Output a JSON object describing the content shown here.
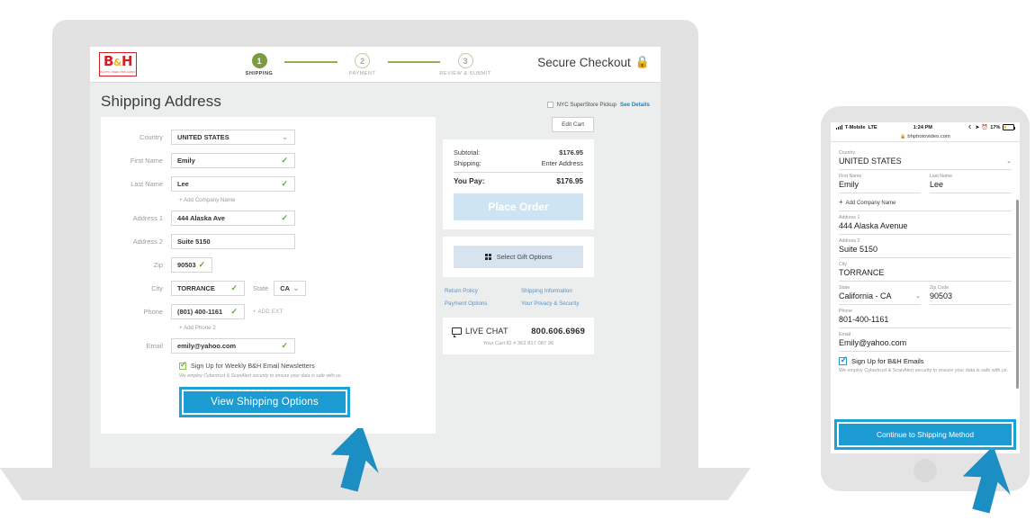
{
  "desktop": {
    "brand": {
      "name": "B&H",
      "tagline": "PHOTO VIDEO PRO AUDIO",
      "logo_color": "#cf2027"
    },
    "stepper": [
      {
        "number": "1",
        "label": "SHIPPING",
        "state": "active"
      },
      {
        "number": "2",
        "label": "PAYMENT",
        "state": "inactive"
      },
      {
        "number": "3",
        "label": "REVIEW & SUBMIT",
        "state": "inactive"
      }
    ],
    "secure_checkout": "Secure Checkout",
    "page_title": "Shipping Address",
    "superstore": {
      "label": "NYC SuperStore Pickup",
      "link": "See Details",
      "checked": false
    },
    "edit_cart": "Edit Cart",
    "form": {
      "country": {
        "label": "Country",
        "value": "UNITED STATES"
      },
      "first_name": {
        "label": "First Name",
        "value": "Emily"
      },
      "last_name": {
        "label": "Last Name",
        "value": "Lee"
      },
      "add_company": "+ Add Company Name",
      "address1": {
        "label": "Address 1",
        "value": "444 Alaska Ave"
      },
      "address2": {
        "label": "Address 2",
        "value": "Suite 5150"
      },
      "zip": {
        "label": "Zip",
        "value": "90503"
      },
      "city": {
        "label": "City",
        "value": "TORRANCE"
      },
      "state": {
        "label": "State",
        "value": "CA"
      },
      "phone": {
        "label": "Phone",
        "value": "(801) 400-1161",
        "add_ext": "+ ADD EXT"
      },
      "add_phone2": "+ Add Phone 2",
      "email": {
        "label": "Email",
        "value": "emily@yahoo.com"
      },
      "newsletter": {
        "label": "Sign Up for Weekly B&H Email Newsletters",
        "checked": true
      },
      "disclaimer": "We employ Cybertrust & ScanAlert security to ensure your data is safe with us.",
      "cta": "View Shipping Options"
    },
    "summary": {
      "subtotal_label": "Subtotal:",
      "subtotal_value": "$176.95",
      "shipping_label": "Shipping:",
      "shipping_value": "Enter Address",
      "total_label": "You Pay:",
      "total_value": "$176.95",
      "place_order": "Place Order",
      "gift_options": "Select Gift Options",
      "links": [
        "Return Policy",
        "Shipping Information",
        "Payment Options",
        "Your Privacy & Security"
      ],
      "live_chat": "LIVE CHAT",
      "phone": "800.606.6969",
      "cart_id": "Your Cart ID # 362 817 087 36"
    },
    "colors": {
      "accent_blue": "#1d9cd3",
      "step_green": "#7d9b41",
      "link_blue": "#5b93c4"
    }
  },
  "mobile": {
    "status": {
      "carrier": "T-Mobile",
      "network": "LTE",
      "time": "1:24 PM",
      "battery": "17%"
    },
    "url": "bhphotovideo.com",
    "form": {
      "country": {
        "label": "Country",
        "value": "UNITED STATES"
      },
      "first_name": {
        "label": "First Name",
        "value": "Emily"
      },
      "last_name": {
        "label": "Last Name",
        "value": "Lee"
      },
      "add_company": "Add Company Name",
      "address1": {
        "label": "Address 1",
        "value": "444 Alaska Avenue"
      },
      "address2": {
        "label": "Address 2",
        "value": "Suite 5150"
      },
      "city": {
        "label": "City",
        "value": "TORRANCE"
      },
      "state": {
        "label": "State",
        "value": "California - CA"
      },
      "zip": {
        "label": "Zip Code",
        "value": "90503"
      },
      "phone": {
        "label": "Phone",
        "value": "801-400-1161"
      },
      "email": {
        "label": "Email",
        "value": "Emily@yahoo.com"
      },
      "newsletter": {
        "label": "Sign Up for B&H Emails",
        "checked": true
      },
      "disclaimer": "We employ Cybertrust & ScanAlert security to ensure your data is safe with us.",
      "cta": "Continue to Shipping Method"
    }
  }
}
